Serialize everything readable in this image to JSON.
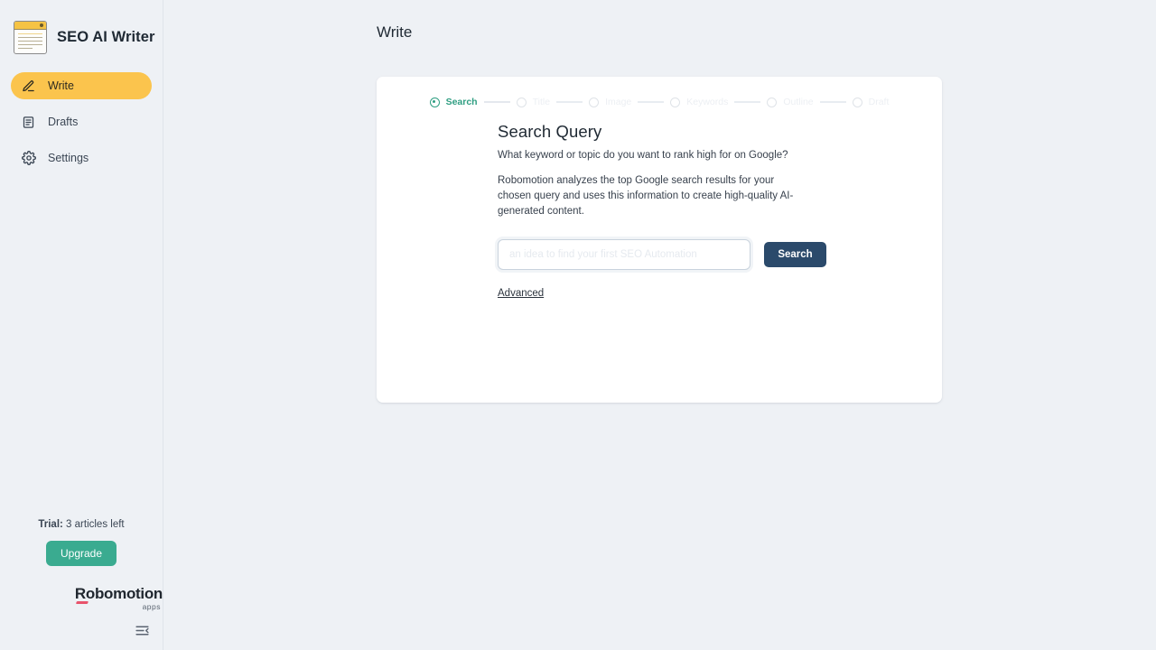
{
  "sidebar": {
    "brand": {
      "name": "SEO AI Writer",
      "logo_icon": "document-window-icon"
    },
    "items": [
      {
        "label": "Write",
        "icon": "pencil-icon"
      },
      {
        "label": "Drafts",
        "icon": "document-list-icon"
      },
      {
        "label": "Settings",
        "icon": "gear-icon"
      }
    ],
    "trial": {
      "label": "Trial:",
      "count": "3",
      "suffix": "articles left",
      "upgrade_label": "Upgrade"
    },
    "footer_logo": {
      "name": "Robomotion",
      "sub": "apps"
    },
    "collapse_icon": "collapse-sidebar-icon"
  },
  "header": {
    "title": "Write"
  },
  "stepper": {
    "steps": [
      {
        "label": "Search",
        "state": "active"
      },
      {
        "label": "Title",
        "state": "inactive"
      },
      {
        "label": "Image",
        "state": "inactive"
      },
      {
        "label": "Keywords",
        "state": "inactive"
      },
      {
        "label": "Outline",
        "state": "inactive"
      },
      {
        "label": "Draft",
        "state": "inactive"
      }
    ]
  },
  "main": {
    "title": "Search Query",
    "subtitle": "What keyword or topic do you want to rank high for on Google?",
    "description": "Robomotion analyzes the top Google search results for your chosen query and uses this information to create high-quality AI-generated content.",
    "search": {
      "value": "",
      "placeholder": "an idea to find your first SEO Automation",
      "button_label": "Search"
    },
    "advanced_label": "Advanced"
  },
  "colors": {
    "accent_yellow": "#fbc44d",
    "accent_teal": "#3aab90",
    "step_active": "#2f9e82",
    "button_navy": "#2b4a6b",
    "page_bg": "#eef1f5"
  }
}
